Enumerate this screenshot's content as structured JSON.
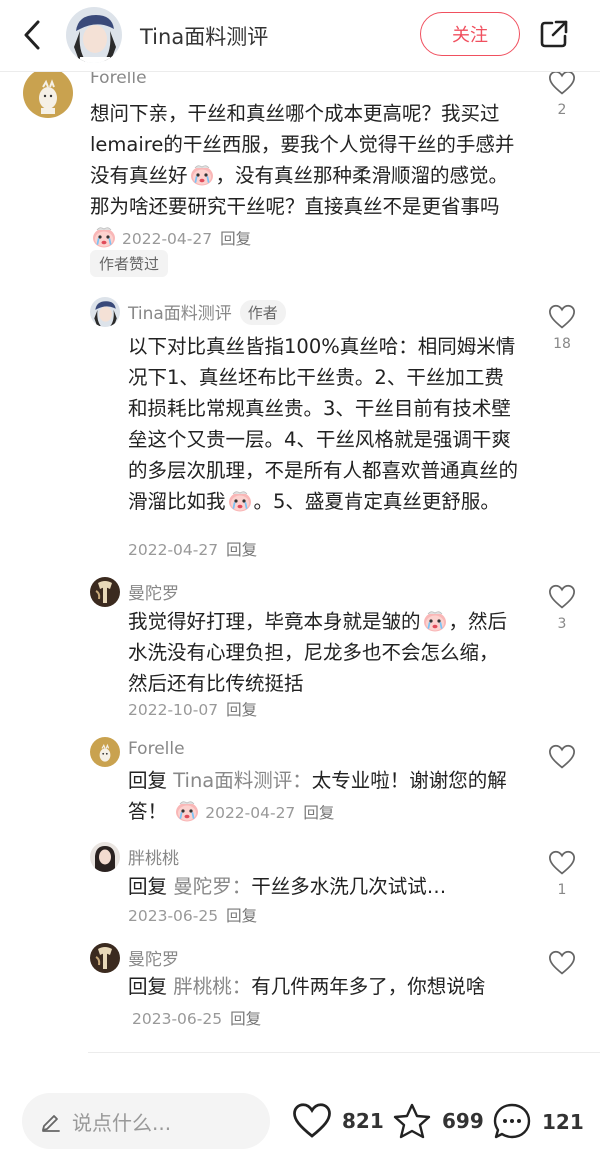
{
  "header": {
    "title": "Tina面料测评",
    "follow_label": "关注"
  },
  "comments": [
    {
      "author": "Forelle",
      "text": "想问下亲，干丝和真丝哪个成本更高呢？我买过lemaire的干丝西服，要我个人觉得干丝的手感并没有真丝好",
      "text_b": "，没有真丝那种柔滑顺溜的感觉。那为啥还要研究干丝呢？直接真丝不是更省事吗",
      "date": "2022-04-27",
      "reply_label": "回复",
      "likes": "2",
      "badge": "作者赞过"
    },
    {
      "author": "Tina面料测评",
      "author_tag": "作者",
      "text": "以下对比真丝皆指100%真丝哈：相同姆米情况下1、真丝坯布比干丝贵。2、干丝加工费和损耗比常规真丝贵。3、干丝目前有技术壁垒这个又贵一层。4、干丝风格就是强调干爽的多层次肌理，不是所有人都喜欢普通真丝的滑溜比如我",
      "text_b": "。5、盛夏肯定真丝更舒服。",
      "date": "2022-04-27",
      "reply_label": "回复",
      "likes": "18"
    },
    {
      "author": "曼陀罗",
      "text": "我觉得好打理，毕竟本身就是皱的",
      "text_b": "，然后水洗没有心理负担，尼龙多也不会怎么缩，然后还有比传统挺括",
      "date": "2022-10-07",
      "reply_label": "回复",
      "likes": "3"
    },
    {
      "author": "Forelle",
      "prefix": "回复",
      "reply_to": "Tina面料测评：",
      "text": "太专业啦！谢谢您的解答！",
      "date": "2022-04-27",
      "reply_label": "回复",
      "likes": ""
    },
    {
      "author": "胖桃桃",
      "prefix": "回复",
      "reply_to": "曼陀罗：",
      "text": "干丝多水洗几次试试…",
      "date": "2023-06-25",
      "reply_label": "回复",
      "likes": "1"
    },
    {
      "author": "曼陀罗",
      "prefix": "回复",
      "reply_to": "胖桃桃：",
      "text": "有几件两年多了，你想说啥",
      "date": "2023-06-25",
      "reply_label": "回复",
      "likes": ""
    }
  ],
  "bottom": {
    "input_placeholder": "说点什么...",
    "likes": "821",
    "favorites": "699",
    "comments": "121"
  },
  "colors": {
    "accent": "#f0505f",
    "muted": "#888888"
  }
}
